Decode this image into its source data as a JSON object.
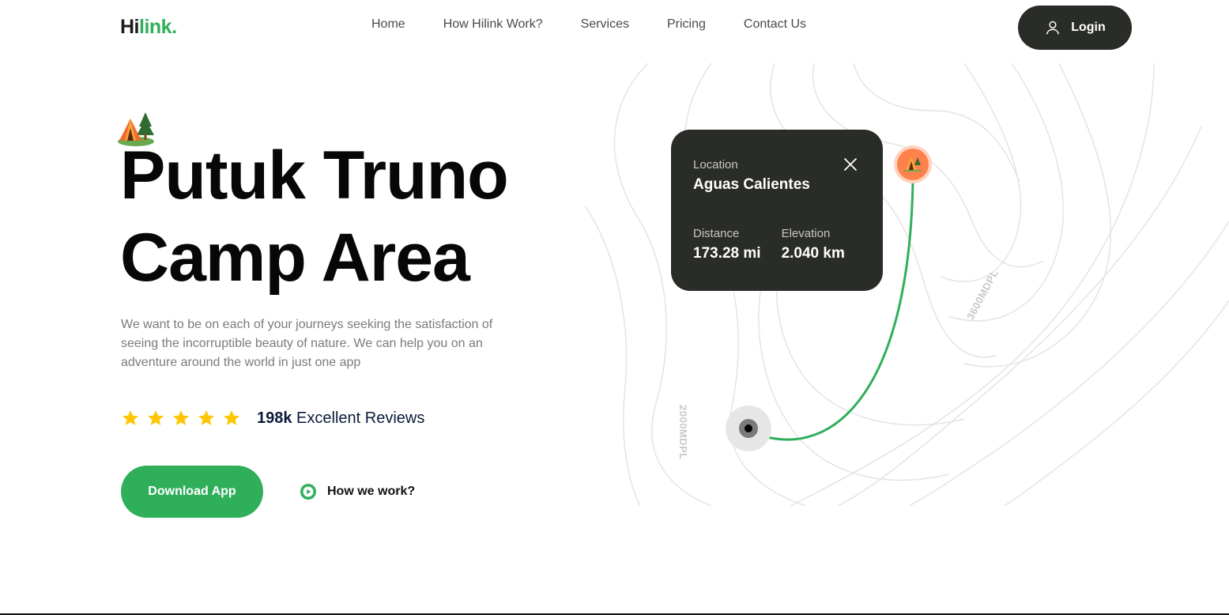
{
  "brand": {
    "logo_main": "Hi",
    "logo_accent": "link."
  },
  "nav": {
    "items": [
      "Home",
      "How Hilink Work?",
      "Services",
      "Pricing",
      "Contact Us"
    ],
    "login_label": "Login"
  },
  "hero": {
    "title_line1": "Putuk Truno",
    "title_line2": "Camp Area",
    "description": "We want to be on each of your journeys seeking the satisfaction of seeing the incorruptible beauty of nature. We can help you on an adventure around the world in just one app",
    "rating_stars": 5,
    "reviews_count": "198k",
    "reviews_label": " Excellent Reviews",
    "download_label": "Download App",
    "how_label": "How we work?"
  },
  "map": {
    "contour_label_1": "2000MDPL",
    "contour_label_2": "3600MDPL",
    "location_label": "Location",
    "location_value": "Aguas Calientes",
    "distance_label": "Distance",
    "distance_value": "173.28 mi",
    "elevation_label": "Elevation",
    "elevation_value": "2.040 km"
  },
  "colors": {
    "accent_green": "#30af5b",
    "dark": "#292c27",
    "star": "#fec601",
    "pin": "#ff814c"
  }
}
